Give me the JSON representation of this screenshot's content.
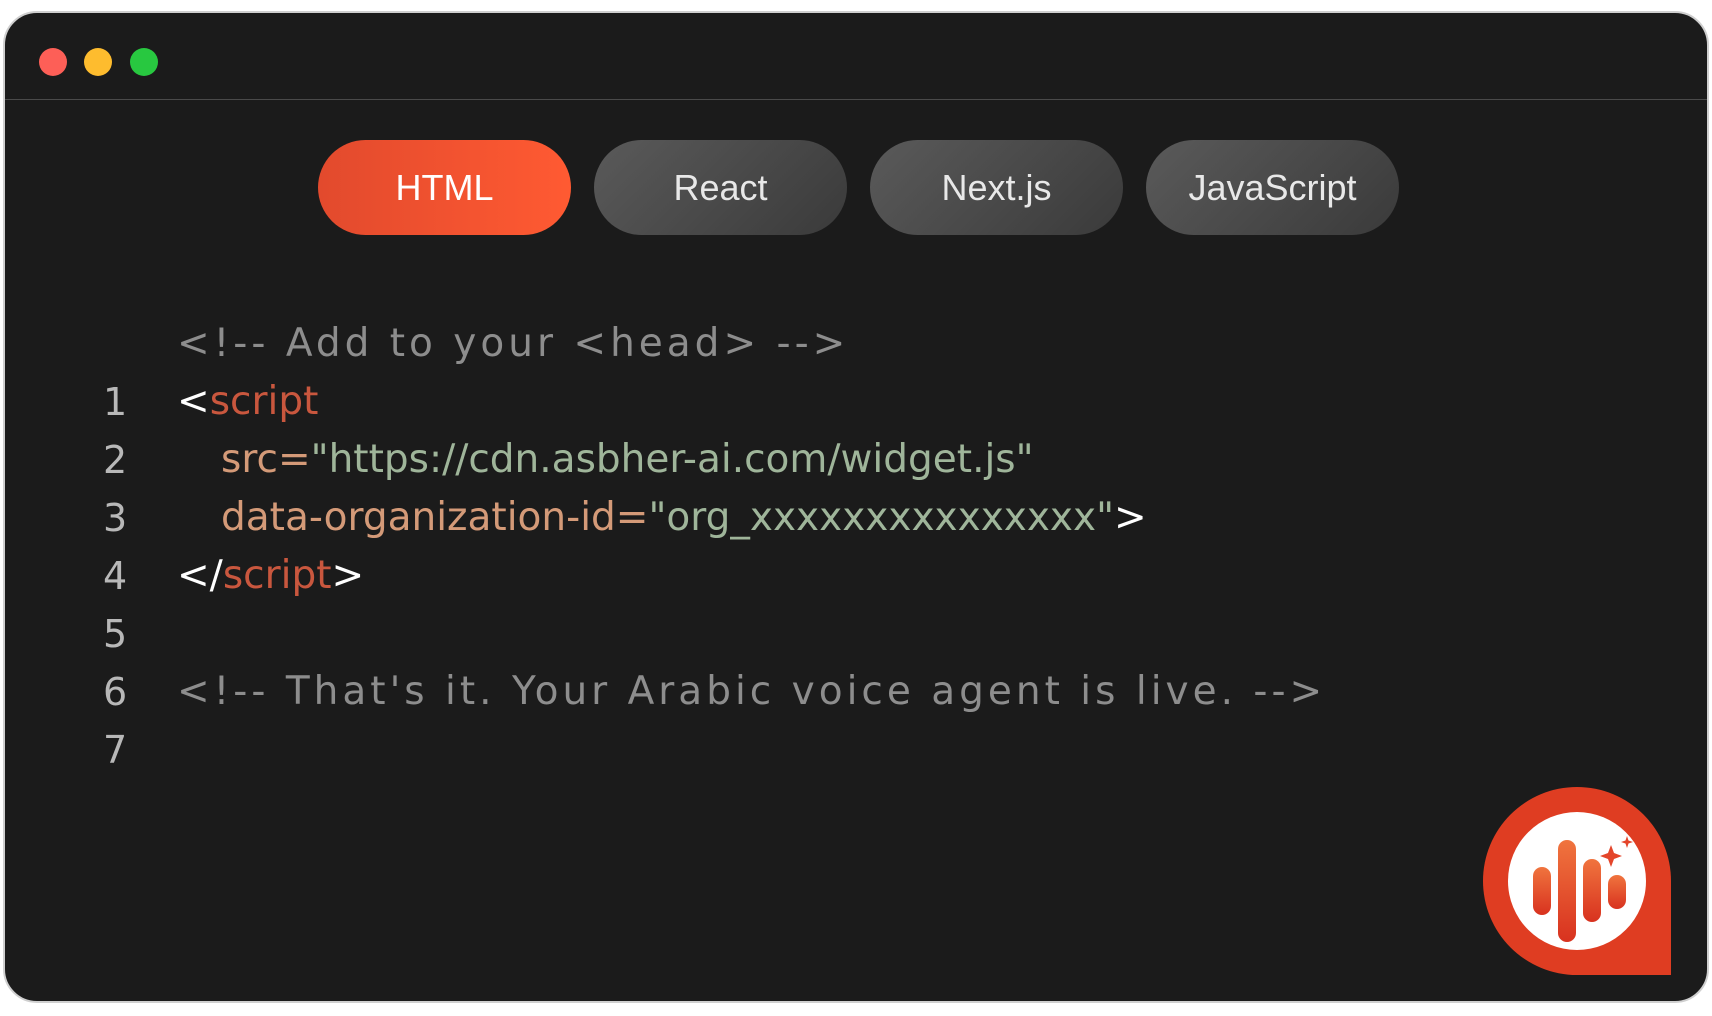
{
  "tabs": [
    {
      "label": "HTML",
      "active": true
    },
    {
      "label": "React",
      "active": false
    },
    {
      "label": "Next.js",
      "active": false
    },
    {
      "label": "JavaScript",
      "active": false
    }
  ],
  "code": {
    "line_numbers": [
      "1",
      "2",
      "3",
      "4",
      "5",
      "6",
      "7"
    ],
    "line1_comment": "<!-- Add to your <head> -->",
    "line2_open": "<",
    "line2_tag": "script",
    "line3_attr": "src=",
    "line3_value": "\"https://cdn.asbher-ai.com/widget.js\"",
    "line4_attr": "data-organization-id=",
    "line4_value": "\"org_xxxxxxxxxxxxxxx\"",
    "line4_close": ">",
    "line5_open": "</",
    "line5_tag": "script",
    "line5_close": ">",
    "line7_comment": "<!-- That's it. Your Arabic voice agent is live. -->"
  },
  "colors": {
    "accent": "#e24a2d",
    "background": "#1b1b1b",
    "comment": "#8d8d8d",
    "tag": "#c9573e",
    "attribute": "#d49a78",
    "string": "#9fb59a"
  },
  "icons": {
    "voice_widget": "voice-wave-sparkle-icon"
  }
}
